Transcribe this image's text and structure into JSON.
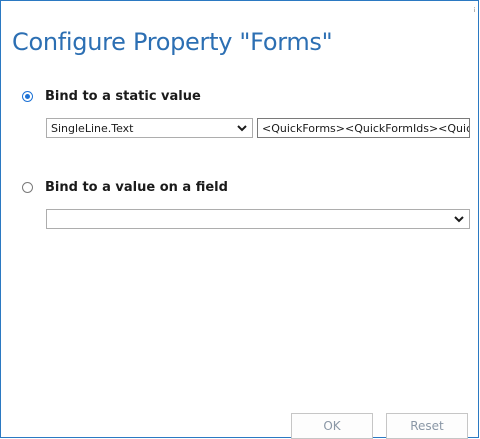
{
  "dialog": {
    "title": "Configure Property \"Forms\"",
    "corner_glyph": "ꜟ"
  },
  "static_option": {
    "label": "Bind to a static value",
    "selected": true,
    "type_select_value": "SingleLine.Text",
    "value_input": "<QuickForms><QuickFormIds><QuickFo"
  },
  "field_option": {
    "label": "Bind to a value on a field",
    "selected": false,
    "field_select_value": ""
  },
  "buttons": {
    "ok": "OK",
    "reset": "Reset"
  },
  "colors": {
    "accent": "#2c6fb3",
    "radio_selected": "#1e73d6",
    "border": "#2b79c2"
  },
  "icons": {
    "dropdown": "chevron-down-icon"
  }
}
